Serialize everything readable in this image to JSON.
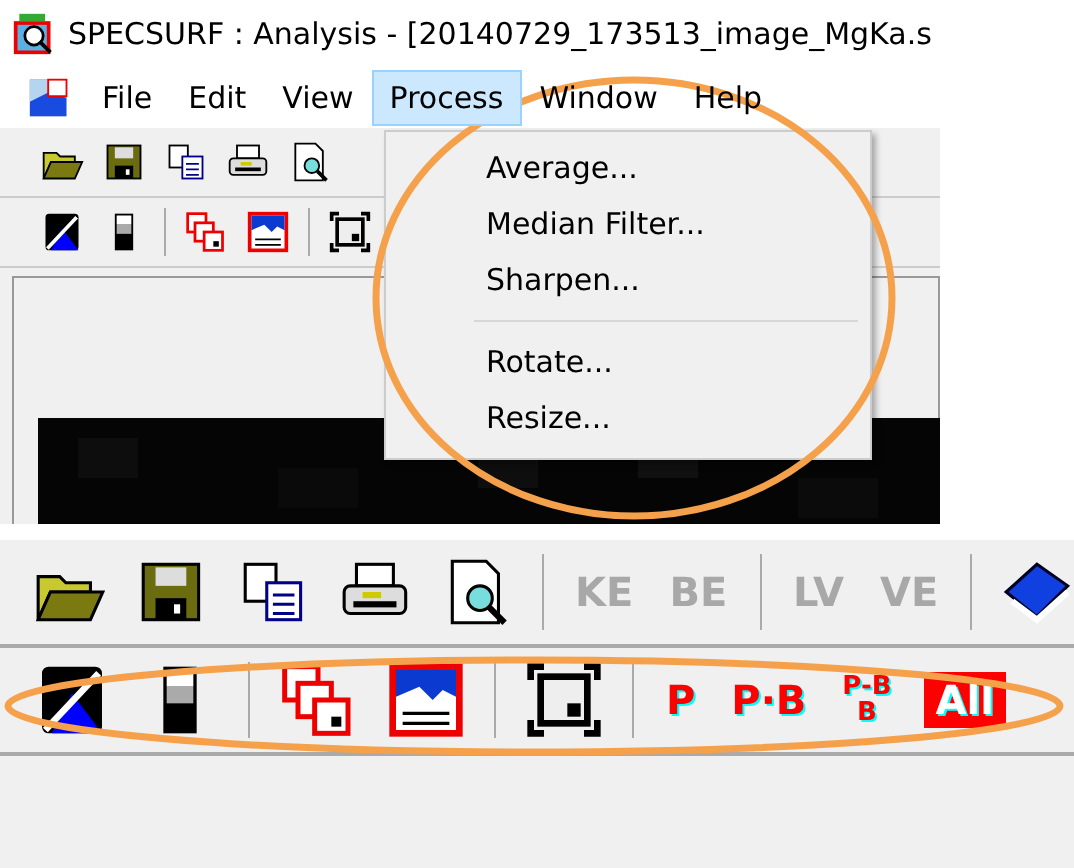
{
  "title_bar": {
    "title": "SPECSURF : Analysis  - [20140729_173513_image_MgKa.s"
  },
  "menu_bar": [
    {
      "label": "File",
      "selected": false
    },
    {
      "label": "Edit",
      "selected": false
    },
    {
      "label": "View",
      "selected": false
    },
    {
      "label": "Process",
      "selected": true
    },
    {
      "label": "Window",
      "selected": false
    },
    {
      "label": "Help",
      "selected": false
    }
  ],
  "toolbar_row_1": [
    {
      "kind": "open"
    },
    {
      "kind": "save"
    },
    {
      "kind": "copy"
    },
    {
      "kind": "print"
    },
    {
      "kind": "preview"
    }
  ],
  "toolbar_row_2": [
    {
      "kind": "contrast"
    },
    {
      "kind": "brightness"
    },
    {
      "kind": "sep"
    },
    {
      "kind": "windows"
    },
    {
      "kind": "spectrum"
    },
    {
      "kind": "sep"
    },
    {
      "kind": "fit"
    }
  ],
  "process_menu": {
    "circled": true,
    "items": [
      {
        "kind": "item",
        "label": "Average..."
      },
      {
        "kind": "item",
        "label": "Median Filter..."
      },
      {
        "kind": "item",
        "label": "Sharpen..."
      },
      {
        "kind": "separator"
      },
      {
        "kind": "item",
        "label": "Rotate..."
      },
      {
        "kind": "item",
        "label": "Resize..."
      }
    ]
  },
  "zoomed_toolbar": {
    "row_1": {
      "buttons": [
        {
          "kind": "open"
        },
        {
          "kind": "save"
        },
        {
          "kind": "copy"
        },
        {
          "kind": "print"
        },
        {
          "kind": "preview"
        },
        {
          "kind": "sep"
        },
        {
          "kind": "text",
          "label": "KE",
          "disabled": true
        },
        {
          "kind": "text",
          "label": "BE",
          "disabled": true
        },
        {
          "kind": "sep"
        },
        {
          "kind": "text",
          "label": "LV",
          "disabled": true
        },
        {
          "kind": "text",
          "label": "VE",
          "disabled": true
        },
        {
          "kind": "sep"
        },
        {
          "kind": "book"
        }
      ]
    },
    "row_2": {
      "circled": true,
      "buttons": [
        {
          "kind": "contrast"
        },
        {
          "kind": "brightness"
        },
        {
          "kind": "sep"
        },
        {
          "kind": "windows"
        },
        {
          "kind": "spectrum"
        },
        {
          "kind": "sep"
        },
        {
          "kind": "fit"
        },
        {
          "kind": "sep"
        },
        {
          "kind": "text",
          "label": "P",
          "disabled": false
        },
        {
          "kind": "text",
          "label": "P·B",
          "disabled": false
        },
        {
          "kind": "text",
          "label": "P-B\nB",
          "disabled": false
        },
        {
          "kind": "boxed",
          "label": "All",
          "disabled": false
        }
      ]
    }
  }
}
